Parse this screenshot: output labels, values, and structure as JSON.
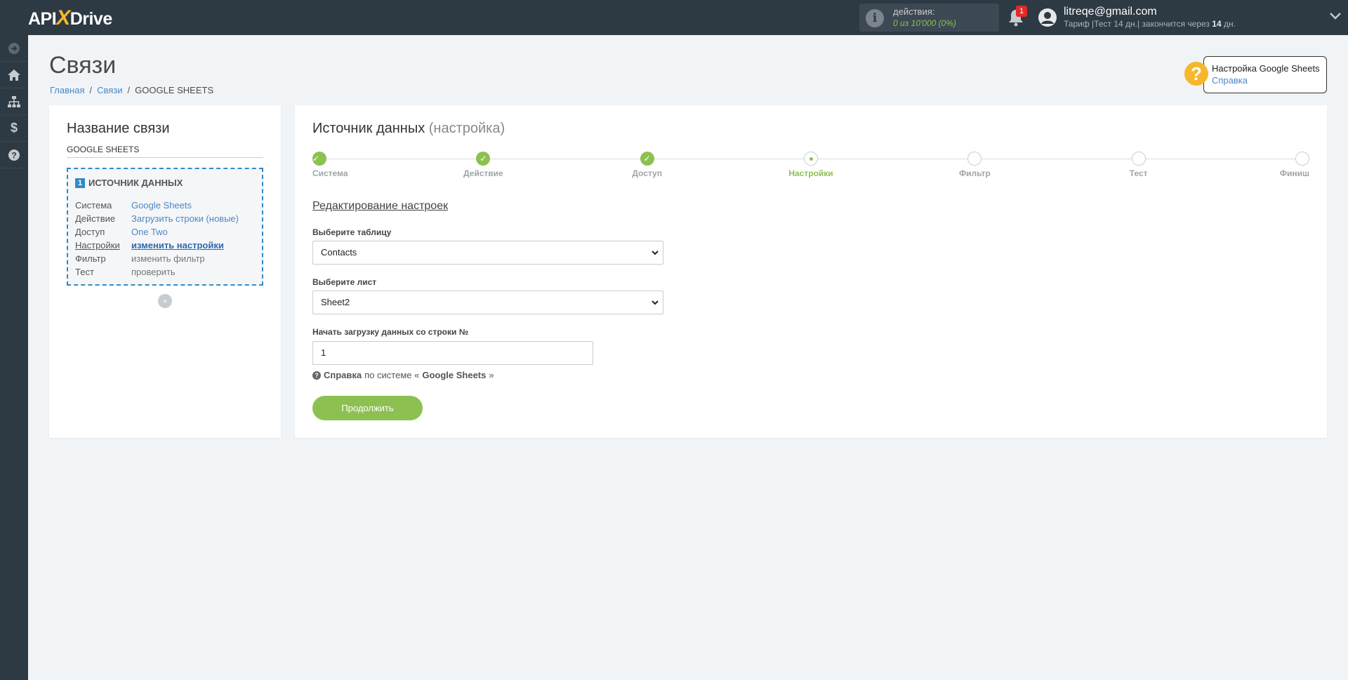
{
  "app": {
    "logo": {
      "prefix": "API",
      "x": "X",
      "suffix": "Drive"
    }
  },
  "topbar": {
    "actions_label": "действия:",
    "actions_value": "0 из 10'000 (0%)",
    "notifications_count": "1",
    "user_email": "litreqe@gmail.com",
    "plan_prefix": "Тариф |Тест 14 дн.| закончится через ",
    "plan_days": "14",
    "plan_suffix": " дн."
  },
  "sidebar": {
    "items": [
      "toggle-icon",
      "home-icon",
      "sitemap-icon",
      "dollar-icon",
      "question-icon"
    ]
  },
  "page": {
    "title": "Связи",
    "breadcrumb": [
      "Главная",
      "Связи",
      "GOOGLE SHEETS"
    ]
  },
  "help_widget": {
    "title": "Настройка Google Sheets",
    "link": "Справка"
  },
  "connection": {
    "title": "Название связи",
    "name": "GOOGLE SHEETS",
    "source": {
      "number": "1",
      "heading": "ИСТОЧНИК ДАННЫХ",
      "rows": [
        {
          "key": "Система",
          "value": "Google Sheets"
        },
        {
          "key": "Действие",
          "value": "Загрузить строки (новые)"
        },
        {
          "key": "Доступ",
          "value": "One Two"
        },
        {
          "key": "Настройки",
          "value": "изменить настройки"
        },
        {
          "key": "Фильтр",
          "value": "изменить фильтр"
        },
        {
          "key": "Тест",
          "value": "проверить"
        }
      ]
    },
    "add_label": "+"
  },
  "main": {
    "title": "Источник данных",
    "title_muted": "(настройка)",
    "steps": [
      {
        "label": "Система",
        "state": "done"
      },
      {
        "label": "Действие",
        "state": "done"
      },
      {
        "label": "Доступ",
        "state": "done"
      },
      {
        "label": "Настройки",
        "state": "current"
      },
      {
        "label": "Фильтр",
        "state": "todo"
      },
      {
        "label": "Тест",
        "state": "todo"
      },
      {
        "label": "Финиш",
        "state": "todo"
      }
    ],
    "section_title": "Редактирование настроек",
    "table_label": "Выберите таблицу",
    "table_value": "Contacts",
    "sheet_label": "Выберите лист",
    "sheet_value": "Sheet2",
    "start_row_label": "Начать загрузку данных со строки №",
    "start_row_value": "1",
    "help_prefix": "Справка",
    "help_middle": " по системе «",
    "help_system": "Google Sheets",
    "help_suffix": "»",
    "continue_label": "Продолжить"
  },
  "colors": {
    "accent_green": "#8cc152",
    "link_blue": "#4a87c7",
    "dark_bar": "#2d3943",
    "help_yellow": "#f5b72b"
  }
}
